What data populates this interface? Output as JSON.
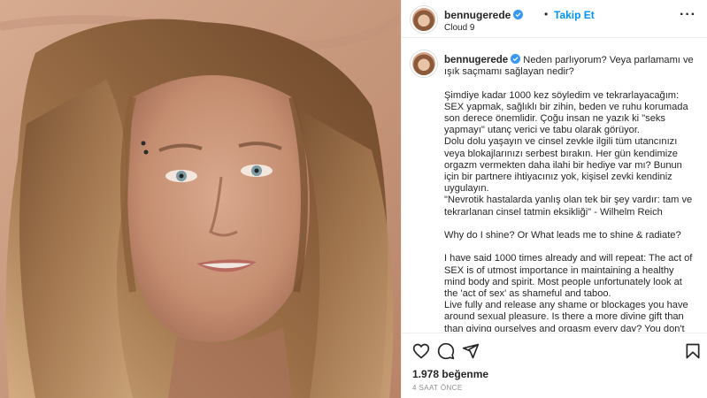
{
  "post": {
    "username": "bennugerede",
    "follow_label": "Takip Et",
    "separator": "•",
    "location": "Cloud 9",
    "more_icon": "ellipsis-icon",
    "caption_first_line": " Neden parlıyorum? Veya parlamamı ve ışık saçmamı sağlayan nedir?",
    "caption_body": "Şimdiye kadar 1000 kez söyledim ve tekrarlayacağım: SEX yapmak, sağlıklı bir zihin, beden ve ruhu korumada son derece önemlidir. Çoğu insan ne yazık ki \"seks yapmayı\" utanç verici ve tabu olarak görüyor.\nDolu dolu yaşayın ve cinsel zevkle ilgili tüm utancınızı veya blokajlarınızı serbest bırakın. Her gün kendimize orgazm vermekten daha ilahi bir hediye var mı? Bunun için bir partnere ihtiyacınız yok, kişisel zevki kendiniz uygulayın.\n\"Nevrotik hastalarda yanlış olan tek bir şey vardır: tam ve tekrarlanan cinsel tatmin eksikliği\" - Wilhelm Reich\n\nWhy do I shine? Or What leads me to shine & radiate?\n\nI have said 1000 times already and will repeat: The act of SEX is of utmost importance in maintaining a healthy mind body and spirit. Most people unfortunately look at the 'act of sex' as shameful and taboo.\nLive fully and release any shame or blockages you have around sexual pleasure. Is there a more divine gift than than giving ourselves and orgasm every day? You don't need a partner for this, self pleasure is an option.\n\"There is only one thing wrong with neurotic patients: the lack of",
    "likes": "1.978 beğenme",
    "timestamp": "4 SAAT ÖNCE"
  },
  "icons": {
    "verified": "verified-badge-icon",
    "like": "heart-icon",
    "comment": "comment-icon",
    "share": "paper-plane-icon",
    "save": "bookmark-icon"
  },
  "colors": {
    "link_blue": "#0095f6",
    "verified_blue": "#3897f0",
    "text": "#262626",
    "muted": "#8e8e8e"
  }
}
